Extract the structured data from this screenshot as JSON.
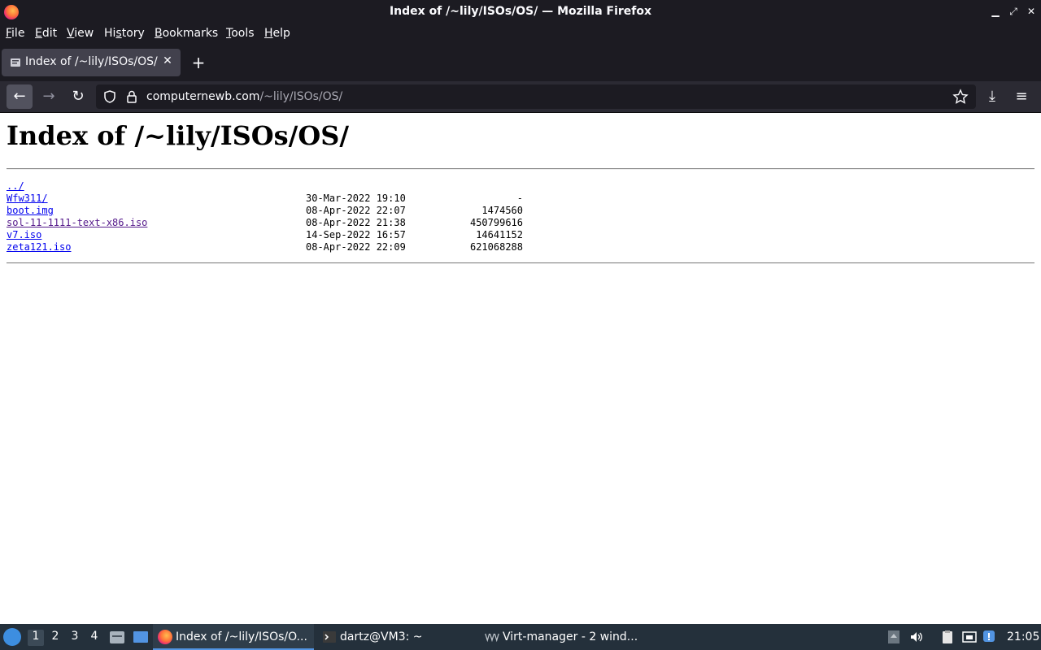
{
  "window": {
    "title": "Index of /~lily/ISOs/OS/ — Mozilla Firefox",
    "minimize": "▁",
    "maximize": "⤢",
    "close": "✕"
  },
  "menubar": {
    "items": [
      {
        "pre": "",
        "u": "F",
        "post": "ile"
      },
      {
        "pre": "",
        "u": "E",
        "post": "dit"
      },
      {
        "pre": "",
        "u": "V",
        "post": "iew"
      },
      {
        "pre": "Hi",
        "u": "s",
        "post": "tory"
      },
      {
        "pre": "",
        "u": "B",
        "post": "ookmarks"
      },
      {
        "pre": "",
        "u": "T",
        "post": "ools"
      },
      {
        "pre": "",
        "u": "H",
        "post": "elp"
      }
    ]
  },
  "tabs": {
    "active_title": "Index of /~lily/ISOs/OS/",
    "close": "✕",
    "new_tab": "+"
  },
  "nav": {
    "back": "←",
    "forward": "→",
    "reload": "↻",
    "download": "⤓",
    "menu": "≡",
    "url_host": "computernewb.com",
    "url_path": "/~lily/ISOs/OS/"
  },
  "page": {
    "heading": "Index of /~lily/ISOs/OS/",
    "parent_link": "../",
    "entries": [
      {
        "name": "Wfw311/",
        "date": "30-Mar-2022 19:10",
        "size": "-"
      },
      {
        "name": "boot.img",
        "date": "08-Apr-2022 22:07",
        "size": "1474560"
      },
      {
        "name": "sol-11-1111-text-x86.iso",
        "date": "08-Apr-2022 21:38",
        "size": "450799616"
      },
      {
        "name": "v7.iso",
        "date": "14-Sep-2022 16:57",
        "size": "14641152"
      },
      {
        "name": "zeta121.iso",
        "date": "08-Apr-2022 22:09",
        "size": "621068288"
      }
    ]
  },
  "taskbar": {
    "workspaces": [
      "1",
      "2",
      "3",
      "4"
    ],
    "items": [
      {
        "label": "Index of /~lily/ISOs/O..."
      },
      {
        "label": "dartz@VM3: ~"
      },
      {
        "label": "Virt-manager - 2 wind..."
      }
    ],
    "clock": "21:05"
  },
  "colors": {
    "link": "#0000ee",
    "visited_link": "#551a8b",
    "chrome_dark": "#1c1b22",
    "taskbar": "#24303b"
  }
}
